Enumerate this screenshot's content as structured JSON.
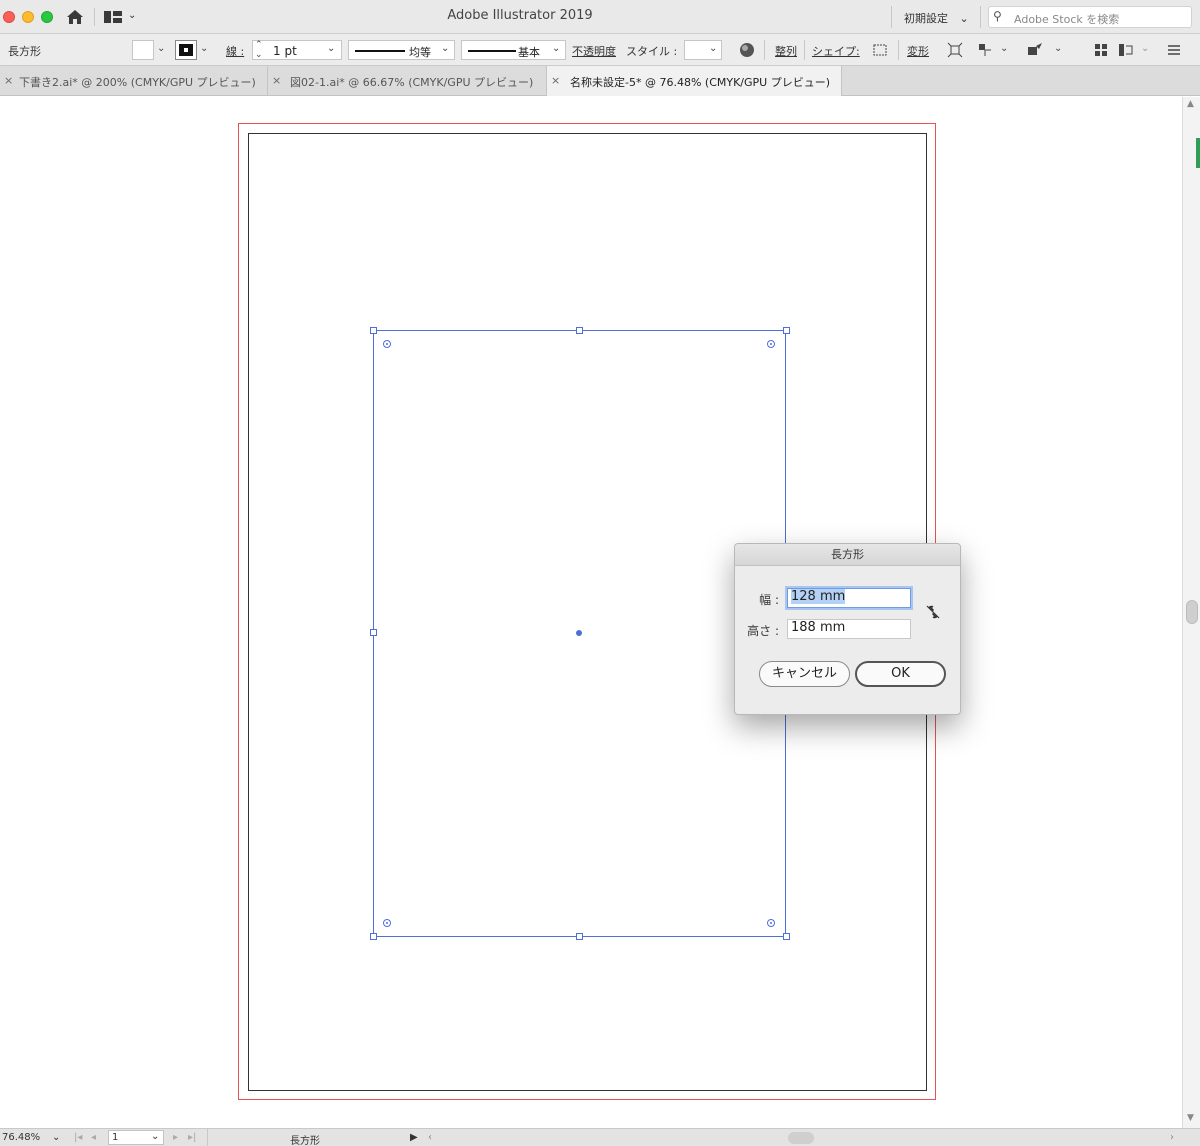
{
  "window": {
    "title": "Adobe Illustrator 2019",
    "workspace_preset": "初期設定",
    "search_placeholder": "Adobe Stock を検索"
  },
  "controlbar": {
    "object_type": "長方形",
    "stroke_label": "線 :",
    "stroke_weight": "1 pt",
    "stroke_profile": "均等",
    "brush": "基本",
    "opacity_label": "不透明度",
    "style_label": "スタイル :",
    "align_label": "整列",
    "shape_label": "シェイプ:",
    "transform_label": "変形"
  },
  "tabs": [
    {
      "label": "下書き2.ai* @ 200% (CMYK/GPU プレビュー)",
      "active": false
    },
    {
      "label": "図02-1.ai* @ 66.67% (CMYK/GPU プレビュー)",
      "active": false
    },
    {
      "label": "名称未設定-5* @ 76.48% (CMYK/GPU プレビュー)",
      "active": true
    }
  ],
  "dialog": {
    "title": "長方形",
    "width_label": "幅 :",
    "width_value": "128 mm",
    "height_label": "高さ :",
    "height_value": "188 mm",
    "cancel_label": "キャンセル",
    "ok_label": "OK"
  },
  "statusbar": {
    "zoom": "76.48%",
    "artboard_number": "1",
    "current_tool": "長方形"
  },
  "colors": {
    "selection": "#4f6fd8",
    "bleed": "#e55454",
    "ok_border": "#555555"
  },
  "icons": [
    "home-icon",
    "workspace-switcher-icon",
    "search-icon",
    "recolor-icon",
    "align-icon",
    "shape-bounds-icon",
    "transform-icon",
    "link-proportions-icon"
  ]
}
